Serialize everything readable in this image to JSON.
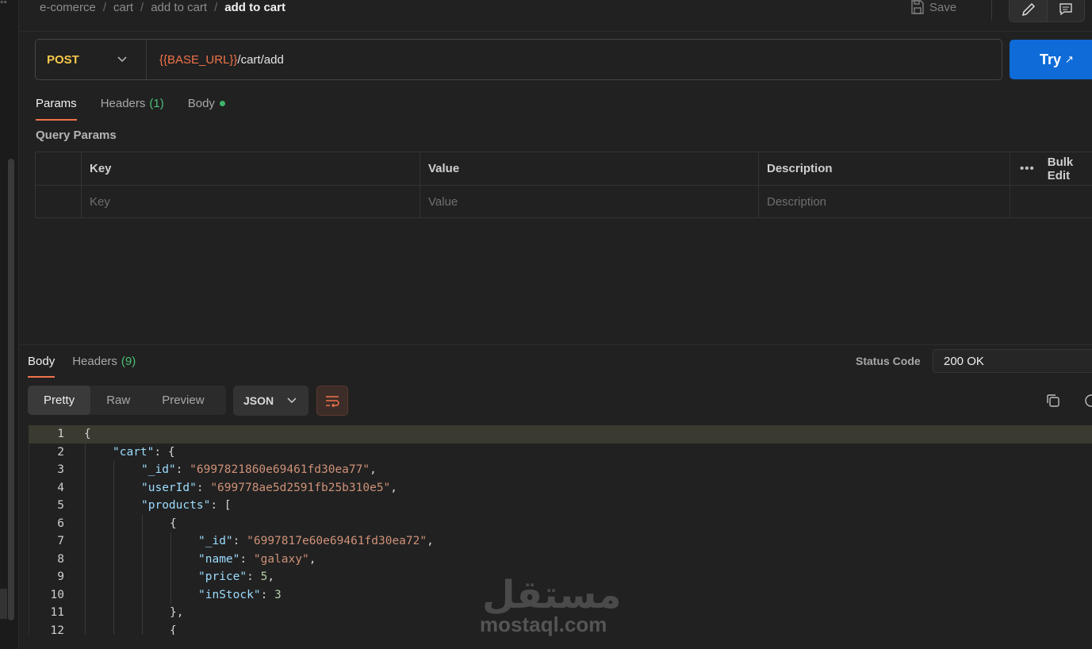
{
  "breadcrumb": {
    "items": [
      "e-comerce",
      "cart",
      "add to cart"
    ],
    "current": "add to cart",
    "separator": "/"
  },
  "toolbar": {
    "save_label": "Save",
    "edit_icon": "pencil-icon",
    "comment_icon": "comment-icon"
  },
  "request": {
    "method": "POST",
    "url_variable": "{{BASE_URL}}",
    "url_path": "/cart/add",
    "try_label": "Try",
    "try_icon": "↗"
  },
  "request_tabs": [
    {
      "label": "Params",
      "count": "",
      "active": true
    },
    {
      "label": "Headers",
      "count": "(1)",
      "active": false
    },
    {
      "label": "Body",
      "count": "",
      "active": false,
      "dot": true
    }
  ],
  "query_params": {
    "label": "Query Params",
    "columns": [
      "Key",
      "Value",
      "Description"
    ],
    "bulk_edit": "Bulk Edit",
    "placeholders": {
      "key": "Key",
      "value": "Value",
      "description": "Description"
    }
  },
  "response": {
    "tabs": [
      {
        "label": "Body",
        "count": "",
        "active": true
      },
      {
        "label": "Headers",
        "count": "(9)",
        "active": false
      }
    ],
    "status_label": "Status Code",
    "status_value": "200 OK",
    "formats": [
      "Pretty",
      "Raw",
      "Preview"
    ],
    "active_format": "Pretty",
    "language": "JSON"
  },
  "code_lines": [
    {
      "n": "1",
      "indent": 0,
      "parts": [
        [
          "p",
          "{"
        ]
      ]
    },
    {
      "n": "2",
      "indent": 1,
      "parts": [
        [
          "k",
          "\"cart\""
        ],
        [
          "p",
          ": {"
        ]
      ]
    },
    {
      "n": "3",
      "indent": 2,
      "parts": [
        [
          "k",
          "\"_id\""
        ],
        [
          "p",
          ": "
        ],
        [
          "s",
          "\"6997821860e69461fd30ea77\""
        ],
        [
          "p",
          ","
        ]
      ]
    },
    {
      "n": "4",
      "indent": 2,
      "parts": [
        [
          "k",
          "\"userId\""
        ],
        [
          "p",
          ": "
        ],
        [
          "s",
          "\"699778ae5d2591fb25b310e5\""
        ],
        [
          "p",
          ","
        ]
      ]
    },
    {
      "n": "5",
      "indent": 2,
      "parts": [
        [
          "k",
          "\"products\""
        ],
        [
          "p",
          ": ["
        ]
      ]
    },
    {
      "n": "6",
      "indent": 3,
      "parts": [
        [
          "p",
          "{"
        ]
      ]
    },
    {
      "n": "7",
      "indent": 4,
      "parts": [
        [
          "k",
          "\"_id\""
        ],
        [
          "p",
          ": "
        ],
        [
          "s",
          "\"6997817e60e69461fd30ea72\""
        ],
        [
          "p",
          ","
        ]
      ]
    },
    {
      "n": "8",
      "indent": 4,
      "parts": [
        [
          "k",
          "\"name\""
        ],
        [
          "p",
          ": "
        ],
        [
          "s",
          "\"galaxy\""
        ],
        [
          "p",
          ","
        ]
      ]
    },
    {
      "n": "9",
      "indent": 4,
      "parts": [
        [
          "k",
          "\"price\""
        ],
        [
          "p",
          ": "
        ],
        [
          "n",
          "5"
        ],
        [
          "p",
          ","
        ]
      ]
    },
    {
      "n": "10",
      "indent": 4,
      "parts": [
        [
          "k",
          "\"inStock\""
        ],
        [
          "p",
          ": "
        ],
        [
          "n",
          "3"
        ]
      ]
    },
    {
      "n": "11",
      "indent": 3,
      "parts": [
        [
          "p",
          "},"
        ]
      ]
    },
    {
      "n": "12",
      "indent": 3,
      "parts": [
        [
          "p",
          "{"
        ]
      ]
    }
  ],
  "watermark": {
    "arabic": "مستقل",
    "latin": "mostaql.com"
  },
  "colors": {
    "accent": "#f0734a",
    "try_button": "#0e6bd8",
    "method": "#f7c74a",
    "count": "#4cbf76"
  }
}
